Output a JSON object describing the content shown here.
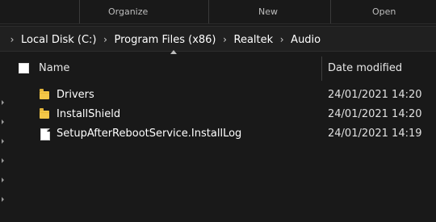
{
  "ribbon": {
    "groups": [
      "Organize",
      "New",
      "Open"
    ]
  },
  "address_bar": {
    "breadcrumbs": [
      "Local Disk (C:)",
      "Program Files (x86)",
      "Realtek",
      "Audio"
    ]
  },
  "file_list": {
    "columns": {
      "name": "Name",
      "date_modified": "Date modified"
    },
    "items": [
      {
        "name": "Drivers",
        "date_modified": "24/01/2021 14:20",
        "icon": "folder-icon"
      },
      {
        "name": "InstallShield",
        "date_modified": "24/01/2021 14:20",
        "icon": "folder-icon"
      },
      {
        "name": "SetupAfterRebootService.InstallLog",
        "date_modified": "24/01/2021 14:19",
        "icon": "file-icon"
      }
    ]
  },
  "colors": {
    "background": "#191919",
    "address_background": "#202020",
    "text": "#ffffff",
    "folder": "#f3c748"
  }
}
